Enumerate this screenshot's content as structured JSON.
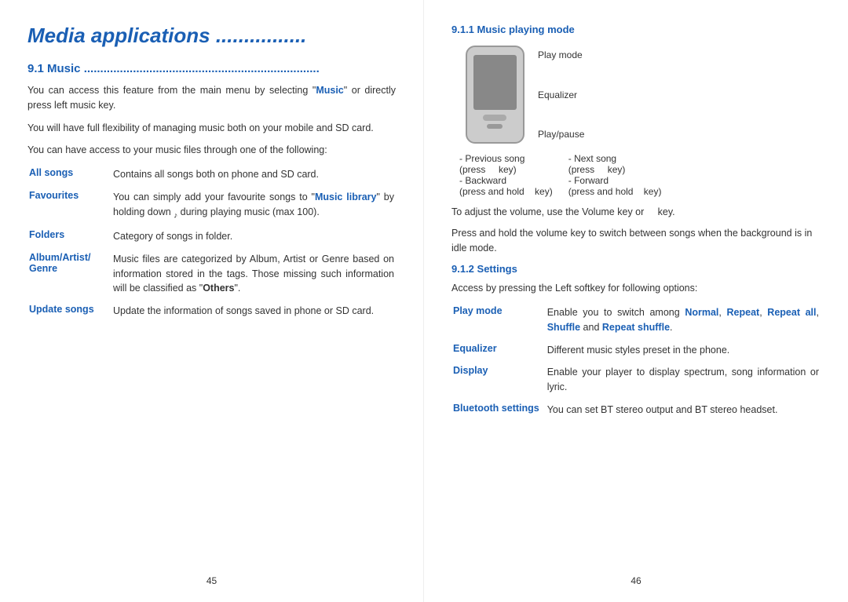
{
  "left_page": {
    "title": "Media applications ................",
    "section_9_1": {
      "heading": "9.1    Music ........................................................................",
      "para1": "You can access this feature from the main menu by selecting \"Music\" or directly press left music key.",
      "para2": "You will have full flexibility of managing music both on your mobile and SD card.",
      "para3": "You can have access to your music files through one of the following:",
      "definitions": [
        {
          "term": "All songs",
          "desc": "Contains all songs both on phone and SD card."
        },
        {
          "term": "Favourites",
          "desc": "You can simply add your favourite songs to \"Music library\" by holding down   during playing music (max 100)."
        },
        {
          "term": "Folders",
          "desc": "Category of songs in folder."
        },
        {
          "term": "Album/Artist/ Genre",
          "desc": "Music files are categorized by Album, Artist or Genre based on information stored in the tags. Those missing such information will be classified as \"Others\"."
        },
        {
          "term": "Update songs",
          "desc": "Update the information of songs saved in phone or SD card."
        }
      ]
    },
    "page_number": "45"
  },
  "right_page": {
    "section_9_1_1": {
      "heading": "9.1.1    Music playing mode",
      "labels": {
        "play_mode": "Play mode",
        "equalizer": "Equalizer",
        "play_pause": "Play/pause"
      },
      "nav_labels": {
        "prev_song": "- Previous song",
        "prev_press": "(press     key)",
        "backward": "- Backward",
        "backward_hold": "(press and hold     key)",
        "next_song": "- Next song",
        "next_press": "(press     key)",
        "forward": "- Forward",
        "forward_hold": "(press and hold     key)"
      },
      "volume_text1": "To adjust the volume, use the Volume key or     key.",
      "volume_text2": "Press and hold the volume key to switch between songs when the background is in idle mode."
    },
    "section_9_1_2": {
      "heading": "9.1.2    Settings",
      "intro": "Access by pressing the Left softkey for following options:",
      "definitions": [
        {
          "term": "Play mode",
          "desc": "Enable you to switch among Normal, Repeat, Repeat all, Shuffle and Repeat shuffle."
        },
        {
          "term": "Equalizer",
          "desc": "Different music styles preset in the phone."
        },
        {
          "term": "Display",
          "desc": "Enable your player to display spectrum, song information or lyric."
        },
        {
          "term": "Bluetooth settings",
          "desc": "You can set BT stereo output and BT stereo headset."
        }
      ]
    },
    "page_number": "46"
  }
}
